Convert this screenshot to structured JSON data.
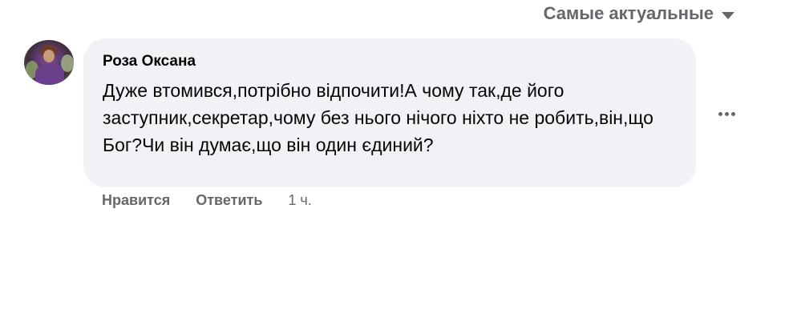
{
  "sort": {
    "label": "Самые актуальные",
    "icon": "caret-down-icon"
  },
  "comment": {
    "author": "Роза Оксана",
    "text": "Дуже втомився,потрібно відпочити!А чому так,де його заступник,секретар,чому без нього нічого ніхто не робить,він,що Бог?Чи він думає,що він один єдиний?",
    "avatar_icon": "user-avatar",
    "bubble_color": "#f0f2f5",
    "more_icon": "more-options-icon"
  },
  "actions": {
    "like_label": "Нравится",
    "reply_label": "Ответить",
    "timestamp": "1 ч."
  },
  "colors": {
    "text_primary": "#050505",
    "text_secondary": "#65676b",
    "background": "#ffffff"
  }
}
